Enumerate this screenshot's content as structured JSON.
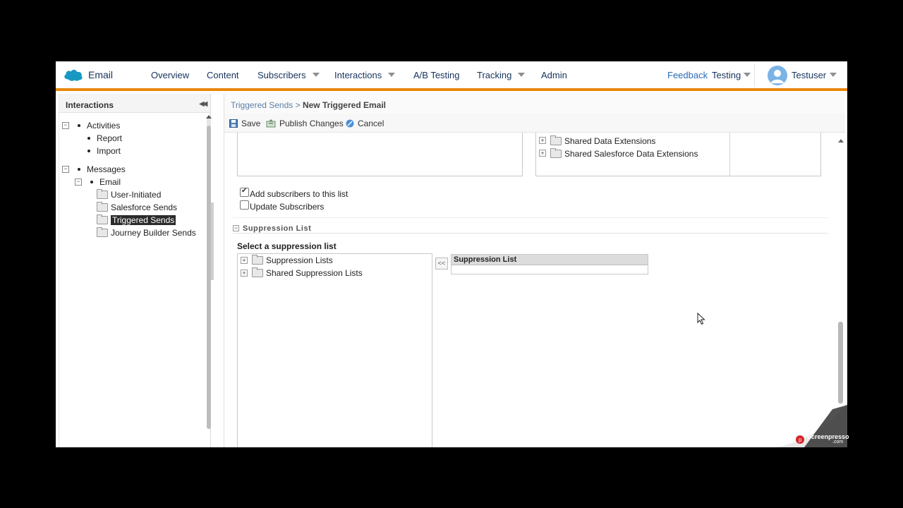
{
  "nav": {
    "app_name": "Email",
    "items": [
      {
        "label": "Overview",
        "dropdown": false
      },
      {
        "label": "Content",
        "dropdown": false
      },
      {
        "label": "Subscribers",
        "dropdown": true
      },
      {
        "label": "Interactions",
        "dropdown": true
      },
      {
        "label": "A/B Testing",
        "dropdown": false
      },
      {
        "label": "Tracking",
        "dropdown": true
      },
      {
        "label": "Admin",
        "dropdown": false
      }
    ],
    "feedback": "Feedback",
    "business_unit": "Testing",
    "user": "Testuser",
    "accent_color": "#e8870d"
  },
  "sidebar": {
    "title": "Interactions",
    "tree": {
      "activities": "Activities",
      "report": "Report",
      "import": "Import",
      "messages": "Messages",
      "email": "Email",
      "user_initiated": "User-Initiated",
      "salesforce_sends": "Salesforce Sends",
      "triggered_sends": "Triggered Sends",
      "journey_builder_sends": "Journey Builder Sends"
    },
    "selected": "Triggered Sends"
  },
  "breadcrumb": {
    "parent": "Triggered Sends",
    "separator": " > ",
    "current": "New Triggered Email"
  },
  "toolbar": {
    "save": "Save",
    "publish": "Publish Changes",
    "cancel": "Cancel"
  },
  "data_extensions": {
    "shared": "Shared Data Extensions",
    "shared_salesforce": "Shared Salesforce Data Extensions"
  },
  "options": {
    "add_subscribers": "Add subscribers to this list",
    "add_subscribers_checked": true,
    "update_subscribers": "Update Subscribers",
    "update_subscribers_checked": false
  },
  "suppression": {
    "section_title": "Suppression List",
    "select_label": "Select a suppression list",
    "folders": [
      "Suppression Lists",
      "Shared Suppression Lists"
    ],
    "move_button": "<<",
    "grid_header": "Suppression List"
  },
  "watermark": {
    "text": "Screenpresso",
    "sub": ".com"
  }
}
